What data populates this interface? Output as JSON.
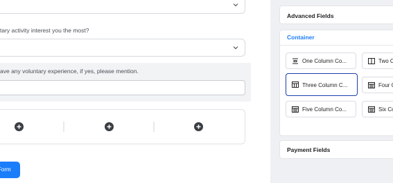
{
  "form": {
    "q1_label": "tary activity interest you the most?",
    "q2_label": "ave any voluntary experience, if yes, please mention.",
    "submit_label": "Form"
  },
  "sidebar": {
    "advanced_title": "Advanced Fields",
    "container_title": "Container",
    "payment_title": "Payment Fields",
    "tiles": [
      {
        "label": "One Column Co...",
        "icon": "one-column-icon"
      },
      {
        "label": "Two C",
        "icon": "two-column-icon"
      },
      {
        "label": "Three Column C...",
        "icon": "three-column-icon"
      },
      {
        "label": "Four C",
        "icon": "four-column-icon"
      },
      {
        "label": "Five Column Co...",
        "icon": "five-column-icon"
      },
      {
        "label": "Six Co",
        "icon": "six-column-icon"
      }
    ]
  },
  "colors": {
    "accent": "#1a7efb",
    "selected_border": "#1b3ea8"
  }
}
